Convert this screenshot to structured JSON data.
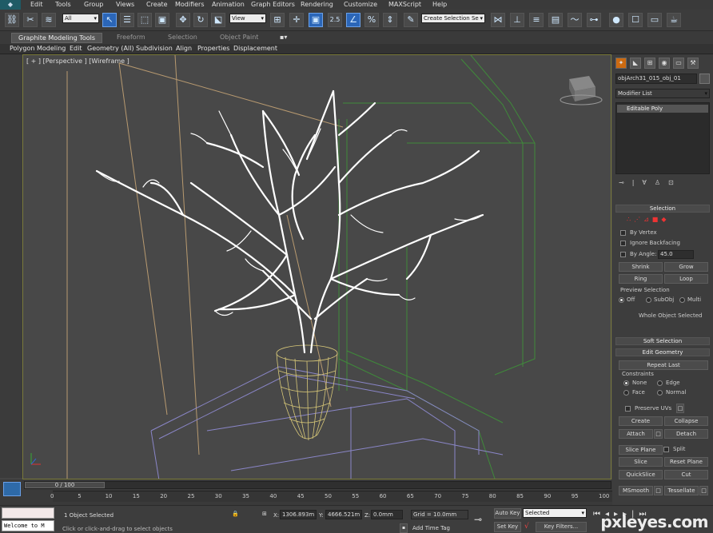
{
  "menu": {
    "items": [
      "Edit",
      "Tools",
      "Group",
      "Views",
      "Create",
      "Modifiers",
      "Animation",
      "Graph Editors",
      "Rendering",
      "Customize",
      "MAXScript",
      "Help"
    ]
  },
  "toolbar": {
    "selection_filter": "All",
    "reference_coord": "View",
    "angle_snap_label": "2.5",
    "named_selection": "Create Selection Se"
  },
  "ribbon": {
    "tabs": [
      "Graphite Modeling Tools",
      "Freeform",
      "Selection",
      "Object Paint"
    ],
    "subtabs": [
      "Polygon Modeling",
      "Edit",
      "Geometry (All)",
      "Subdivision",
      "Align",
      "Properties",
      "Displacement"
    ]
  },
  "viewport": {
    "label": "[ + ] [Perspective ] [Wireframe ]"
  },
  "command_panel": {
    "object_name": "objArch31_015_obj_01",
    "modifier_list": "Modifier List",
    "stack_item": "Editable Poly",
    "selection": {
      "title": "Selection",
      "by_vertex": "By Vertex",
      "ignore_backfacing": "Ignore Backfacing",
      "by_angle": "By Angle:",
      "angle_value": "45.0",
      "shrink": "Shrink",
      "grow": "Grow",
      "ring": "Ring",
      "loop": "Loop",
      "preview_selection": "Preview Selection",
      "preview_options": [
        "Off",
        "SubObj",
        "Multi"
      ],
      "status": "Whole Object Selected"
    },
    "soft_selection": "Soft Selection",
    "edit_geometry": {
      "title": "Edit Geometry",
      "repeat_last": "Repeat Last",
      "constraints": "Constraints",
      "constraint_options": [
        "None",
        "Edge",
        "Face",
        "Normal"
      ],
      "preserve_uvs": "Preserve UVs",
      "buttons": [
        "Create",
        "Collapse",
        "Attach",
        "Detach",
        "Slice Plane",
        "Split",
        "Slice",
        "Reset Plane",
        "QuickSlice",
        "Cut",
        "MSmooth",
        "Tessellate"
      ]
    }
  },
  "timeline": {
    "frame": "0 / 100",
    "ticks": [
      "0",
      "5",
      "10",
      "15",
      "20",
      "25",
      "30",
      "35",
      "40",
      "45",
      "50",
      "55",
      "60",
      "65",
      "70",
      "75",
      "80",
      "85",
      "90",
      "95",
      "100"
    ]
  },
  "status": {
    "maxscript": "Welcome to M",
    "selected": "1 Object Selected",
    "prompt": "Click or click-and-drag to select objects",
    "x_label": "X:",
    "x_value": "1306.893m",
    "y_label": "Y:",
    "y_value": "4666.521m",
    "z_label": "Z:",
    "z_value": "0.0mm",
    "grid": "Grid = 10.0mm",
    "add_time_tag": "Add Time Tag",
    "auto_key": "Auto Key",
    "key_mode": "Selected",
    "set_key": "Set Key",
    "key_filters": "Key Filters..."
  },
  "watermark": "pxleyes.com"
}
